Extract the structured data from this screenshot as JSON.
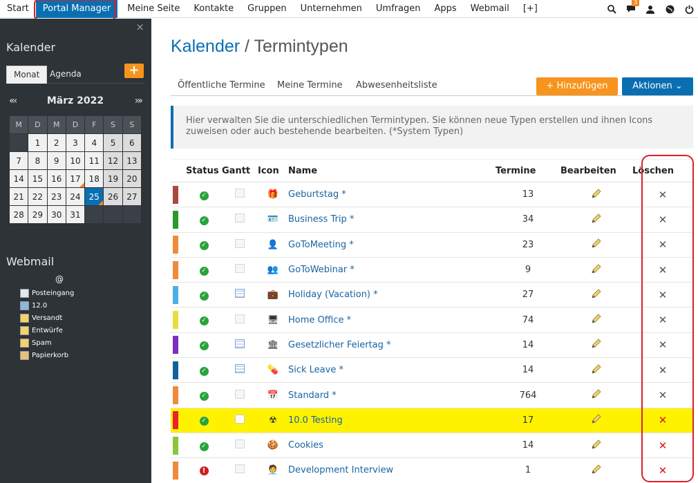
{
  "topnav": {
    "items": [
      "Start",
      "Portal Manager",
      "Meine Seite",
      "Kontakte",
      "Gruppen",
      "Unternehmen",
      "Umfragen",
      "Apps",
      "Webmail",
      "[+]"
    ],
    "active_index": 1,
    "notification_count": "3"
  },
  "sidebar": {
    "calendar_title": "Kalender",
    "tabs": [
      "Monat",
      "Agenda"
    ],
    "add_label": "+",
    "month_label": "März 2022",
    "prev_label": "«‹",
    "next_label": "›»",
    "weekdays": [
      "M",
      "D",
      "M",
      "D",
      "F",
      "S",
      "S"
    ],
    "weeks": [
      [
        "",
        "1",
        "2",
        "3",
        "4",
        "5",
        "6"
      ],
      [
        "7",
        "8",
        "9",
        "10",
        "11",
        "12",
        "13"
      ],
      [
        "14",
        "15",
        "16",
        "17",
        "18",
        "19",
        "20"
      ],
      [
        "21",
        "22",
        "23",
        "24",
        "25",
        "26",
        "27"
      ],
      [
        "28",
        "29",
        "30",
        "31",
        "",
        "",
        ""
      ]
    ],
    "today": "25",
    "marked_days": [
      "17",
      "25"
    ],
    "webmail_title": "Webmail",
    "webmail_at": "@",
    "webmail_folders": [
      {
        "label": "Posteingang",
        "icon": "inbox-icon",
        "color": "#dfe7ef"
      },
      {
        "label": "12.0",
        "icon": "folder-blue-icon",
        "color": "#8fb7de"
      },
      {
        "label": "Versandt",
        "icon": "sent-icon",
        "color": "#f3d36b"
      },
      {
        "label": "Entwürfe",
        "icon": "drafts-icon",
        "color": "#f3d36b"
      },
      {
        "label": "Spam",
        "icon": "spam-icon",
        "color": "#f3d36b"
      },
      {
        "label": "Papierkorb",
        "icon": "trash-icon",
        "color": "#e8c07a"
      }
    ]
  },
  "main": {
    "title_link": "Kalender",
    "title_rest": " / Termintypen",
    "subtabs": [
      "Öffentliche Termine",
      "Meine Termine",
      "Abwesenheitsliste"
    ],
    "add_button": "+ Hinzufügen",
    "actions_button": "Aktionen ⌄",
    "info_text": "Hier verwalten Sie die unterschiedlichen Termintypen. Sie können neue Typen erstellen und ihnen Icons zuweisen oder auch bestehende bearbeiten. (*System Typen)",
    "columns": [
      "",
      "Status",
      "Gantt",
      "Icon",
      "Name",
      "Termine",
      "Bearbeiten",
      "Löschen"
    ],
    "rows": [
      {
        "color": "#a94a40",
        "status": "ok",
        "gantt": "off",
        "icon": "gift-icon",
        "glyph": "🎁",
        "name": "Geburtstag *",
        "count": "13",
        "deletable": false,
        "highlight": false
      },
      {
        "color": "#2a9a2a",
        "status": "ok",
        "gantt": "off",
        "icon": "business-card-icon",
        "glyph": "🪪",
        "name": "Business Trip *",
        "count": "34",
        "deletable": false,
        "highlight": false
      },
      {
        "color": "#f08a3c",
        "status": "ok",
        "gantt": "off",
        "icon": "user-icon",
        "glyph": "👤",
        "name": "GoToMeeting *",
        "count": "23",
        "deletable": false,
        "highlight": false
      },
      {
        "color": "#f08a3c",
        "status": "ok",
        "gantt": "off",
        "icon": "users-icon",
        "glyph": "👥",
        "name": "GoToWebinar *",
        "count": "9",
        "deletable": false,
        "highlight": false
      },
      {
        "color": "#4aaee8",
        "status": "ok",
        "gantt": "on",
        "icon": "suitcase-icon",
        "glyph": "💼",
        "name": "Holiday (Vacation) *",
        "count": "27",
        "deletable": false,
        "highlight": false
      },
      {
        "color": "#e8dc3c",
        "status": "ok",
        "gantt": "off",
        "icon": "computer-icon",
        "glyph": "🖥",
        "name": "Home Office *",
        "count": "74",
        "deletable": false,
        "highlight": false
      },
      {
        "color": "#7a2ec2",
        "status": "ok",
        "gantt": "on",
        "icon": "bank-icon",
        "glyph": "🏛",
        "name": "Gesetzlicher Feiertag *",
        "count": "14",
        "deletable": false,
        "highlight": false
      },
      {
        "color": "#10629e",
        "status": "ok",
        "gantt": "on",
        "icon": "pill-icon",
        "glyph": "💊",
        "name": "Sick Leave *",
        "count": "14",
        "deletable": false,
        "highlight": false
      },
      {
        "color": "#f08a3c",
        "status": "ok",
        "gantt": "off",
        "icon": "calendar-icon",
        "glyph": "📅",
        "name": "Standard *",
        "count": "764",
        "deletable": false,
        "highlight": false
      },
      {
        "color": "#e8232a",
        "status": "ok",
        "gantt": "white",
        "icon": "radiation-icon",
        "glyph": "☢",
        "name": "10.0 Testing",
        "count": "17",
        "deletable": true,
        "highlight": true
      },
      {
        "color": "#8cc43c",
        "status": "ok",
        "gantt": "off",
        "icon": "cookie-icon",
        "glyph": "🍪",
        "name": "Cookies",
        "count": "14",
        "deletable": true,
        "highlight": false
      },
      {
        "color": "#f08a3c",
        "status": "error",
        "gantt": "off",
        "icon": "person-suit-icon",
        "glyph": "🧑‍💼",
        "name": "Development Interview",
        "count": "1",
        "deletable": true,
        "highlight": false
      }
    ]
  }
}
